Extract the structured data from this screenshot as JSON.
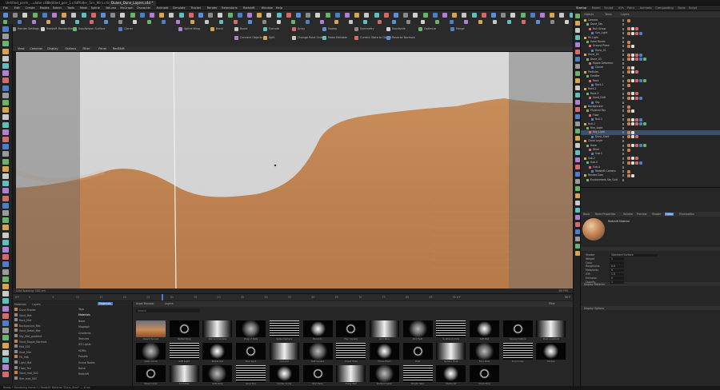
{
  "tabs": [
    {
      "label": "Untitled_perm_...ulator.c4d"
    },
    {
      "label": "Untitled_gen_1.c4d *"
    },
    {
      "label": "Folder_Scn_Mini.c4d"
    },
    {
      "label": "Dunes_Dune_Layers.c4d *"
    }
  ],
  "menu": [
    "File",
    "Edit",
    "Create",
    "Modes",
    "Select",
    "Tools",
    "Mesh",
    "Spline",
    "Volume",
    "MoGraph",
    "Character",
    "Animate",
    "Simulate",
    "Tracker",
    "Render",
    "Extensions",
    "Redshift",
    "Window",
    "Help"
  ],
  "layout_tabs": [
    "Startup",
    "Model",
    "Sculpt",
    "UVs",
    "Paint",
    "Animate",
    "Compositing",
    "Node",
    "Script"
  ],
  "toolbar": {
    "labels": [
      "Render Settings",
      "Redshift RenderView",
      "Subdivision Surface",
      "Cloner",
      "Spline Wrap",
      "Bend",
      "Boole",
      "Extrude",
      "Array",
      "Sweep",
      "Symmetry",
      "Subdivide",
      "Optimize",
      "Merge",
      "Connect Objects",
      "Split",
      "Change Point Order",
      "Make Editable",
      "Current State to Object",
      "Reverse Normals"
    ]
  },
  "viewport": {
    "menu": [
      "View",
      "Cameras",
      "Display",
      "Options",
      "Filter",
      "Panel",
      "RedShift"
    ],
    "status": "Grid Spacing: 100 cm",
    "fps": "60 FPS"
  },
  "timeline": {
    "start": "0 F",
    "end": "90 F",
    "current": "0 F",
    "ticks": [
      "0",
      "5",
      "10",
      "15",
      "20",
      "25",
      "30",
      "35",
      "40",
      "45",
      "50",
      "55",
      "60",
      "65",
      "70",
      "75",
      "80",
      "85",
      "90"
    ]
  },
  "layers": {
    "tabs": [
      "Materials",
      "Layers"
    ],
    "items": [
      "Dune Shader",
      "Sand_Mat",
      "Rock_Mat",
      "Background_Mat",
      "Sand_Detail_Mat",
      "Sky_Mat_gradient",
      "Sand_Ripple_Normals",
      "Mat_002",
      "Dust_Mat",
      "Fill_Mat",
      "Light_Mat",
      "Floor_Tex",
      "Sand_mat_002",
      "Rim_mat_003"
    ]
  },
  "assets": {
    "header": [
      "Asset Browser",
      "Materials",
      "Layers"
    ],
    "categories": [
      "Tags",
      "Materials",
      "Node",
      "Mograph",
      "Gradients",
      "Textures",
      "IES Lights",
      "HDRIs",
      "Presets",
      "Scene Nodes",
      "Noise",
      "Redshift"
    ],
    "filter_label": "Filter",
    "search_placeholder": "Search",
    "thumbs": [
      "Desert Sunset",
      "Dotted Ring",
      "Dot Grid Sphere",
      "Ring of Dots",
      "Spiked Sphere",
      "Barcode",
      "Four Square",
      "Grid Nine",
      "Dot Field",
      "Scattered Dots",
      "Soft Ball",
      "Square Outline",
      "Dark Gradient",
      "Gobo Circle",
      "Soft Light",
      "Radial Dot",
      "Blur Spot",
      "Cylinder",
      "Soft Square",
      "Linear Fade",
      "Focus Point",
      "Halo",
      "Sphere Fade",
      "Four Dots",
      "Scan Lines",
      "Stripes",
      "Noise Lines",
      "Scribbles",
      "Soft Strip",
      "Glow Box",
      "Center Cross",
      "Disc Fade",
      "Fuzzy Ball",
      "Radiant Glow",
      "Bright Tube",
      "Starburst",
      "Clock Face"
    ]
  },
  "objects": {
    "tabs": [
      "Objects",
      "Takes",
      "Layers"
    ],
    "rows": [
      "Camera",
      "Dune_Sky",
      "Null Group",
      "Sun_Light",
      "Fill Light",
      "Sand Dunes",
      "Ground Plane",
      "Dune_01",
      "Dune_02",
      "Dune_03",
      "Ripple Deformer",
      "Cloner",
      "Particles",
      "Emitter",
      "Rock",
      "Rock.1",
      "Rock.2",
      "Rock.3",
      "Sand_Drift",
      "Sky",
      "Background",
      "Physical Sky",
      "Floor",
      "Null.1",
      "Null.2",
      "Rim_Light",
      "Key_Light",
      "Dune_Shell",
      "Cloud Layer",
      "Haze",
      "Wind",
      "Sub.1",
      "Sub.2",
      "Sub.3",
      "Sub.4",
      "Redshift Camera",
      "Render Cam",
      "Environment Sky Grid"
    ]
  },
  "attributes": {
    "tabs": [
      "Basic",
      "Node Properties",
      "Volume",
      "Preview",
      "Shader",
      "Editor",
      "Illumination"
    ],
    "title": "Redshift Material",
    "rows": [
      {
        "label": "Shader",
        "value": "Standard Surface"
      },
      {
        "label": "Weight",
        "value": "1"
      },
      {
        "label": "Color",
        "value": ""
      },
      {
        "label": "Roughness",
        "value": "0.5"
      },
      {
        "label": "Metalness",
        "value": "0"
      },
      {
        "label": "IOR",
        "value": "1.5"
      },
      {
        "label": "Emission",
        "value": "0"
      },
      {
        "label": "Opacity",
        "value": "1"
      }
    ],
    "section2": "Display Material",
    "section3": "Display Options"
  },
  "statusbar": "Ready • Rendering frame 0 / Redshift Material \"Dune_Shell\" — 8 ms",
  "colors": {
    "sand": "#b9804f",
    "sky": "#d8d8d8",
    "accent": "#4d7fc8",
    "orange": "#d67a2a"
  }
}
